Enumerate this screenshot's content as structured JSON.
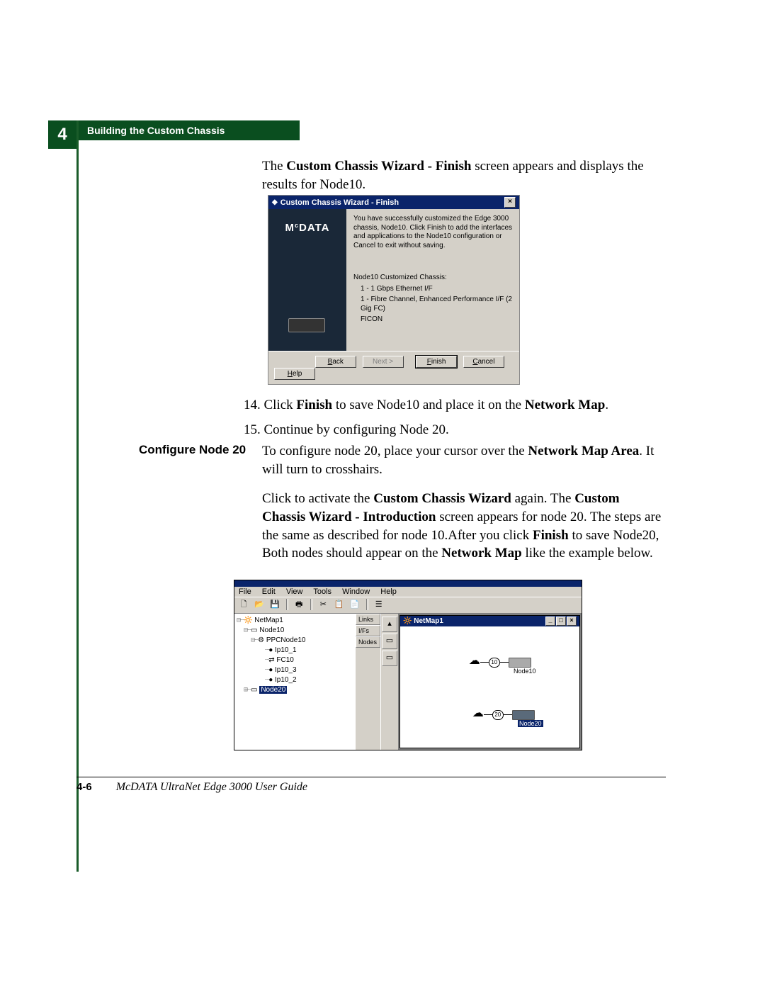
{
  "header": {
    "chapter_number": "4",
    "title": "Building the Custom Chassis"
  },
  "intro": {
    "line1_pre": "The ",
    "line1_bold": "Custom Chassis Wizard - Finish",
    "line1_post": " screen appears and displays the results for Node10."
  },
  "wizard": {
    "title": "Custom Chassis Wizard - Finish",
    "brand": "McDATA",
    "msg": "You have successfully customized the Edge 3000 chassis, Node10. Click Finish to add the interfaces and applications to the Node10 configuration or Cancel to exit without saving.",
    "list_title": "Node10 Customized Chassis:",
    "item1": "1 - 1 Gbps Ethernet I/F",
    "item2": "1 - Fibre Channel, Enhanced Performance I/F (2 Gig FC)",
    "item3": "FICON",
    "btn_back": "< Back",
    "btn_next": "Next >",
    "btn_finish": "Finish",
    "btn_cancel": "Cancel",
    "btn_help": "Help"
  },
  "steps": {
    "s14_num": "14.",
    "s14_a": " Click ",
    "s14_b": "Finish",
    "s14_c": " to save Node10 and place it on the ",
    "s14_d": "Network Map",
    "s14_e": ".",
    "s15_num": "15.",
    "s15_text": " Continue by configuring Node 20."
  },
  "sub_heading": "Configure Node 20",
  "sub": {
    "p1a": "To configure node 20, place your cursor over the ",
    "p1b": "Network Map Area",
    "p1c": ". It will turn to crosshairs.",
    "p2a": "Click to activate the ",
    "p2b": "Custom Chassis Wizard",
    "p2c": " again. The ",
    "p2d": "Custom Chassis Wizard - Introduction",
    "p2e": " screen appears for node 20. The steps are the same as described for node 10.After you click ",
    "p2f": "Finish",
    "p2g": " to save Node20, Both nodes should appear on the ",
    "p2h": "Network Map",
    "p2i": " like the example below."
  },
  "cm": {
    "menu": {
      "file": "File",
      "edit": "Edit",
      "view": "View",
      "tools": "Tools",
      "window": "Window",
      "help": "Help"
    },
    "tabs": {
      "links": "Links",
      "ifs": "I/Fs",
      "nodes": "Nodes"
    },
    "tree": {
      "root": "NetMap1",
      "n10": "Node10",
      "ppc": "PPCNode10",
      "ip1": "Ip10_1",
      "fc": "FC10",
      "ip3": "Ip10_3",
      "ip2": "Ip10_2",
      "n20": "Node20"
    },
    "map": {
      "title": "NetMap1",
      "n10_id": "10",
      "n10_label": "Node10",
      "n20_id": "20",
      "n20_label": "Node20"
    }
  },
  "footer": {
    "page": "4-6",
    "book": "McDATA UltraNet Edge 3000 User Guide"
  }
}
